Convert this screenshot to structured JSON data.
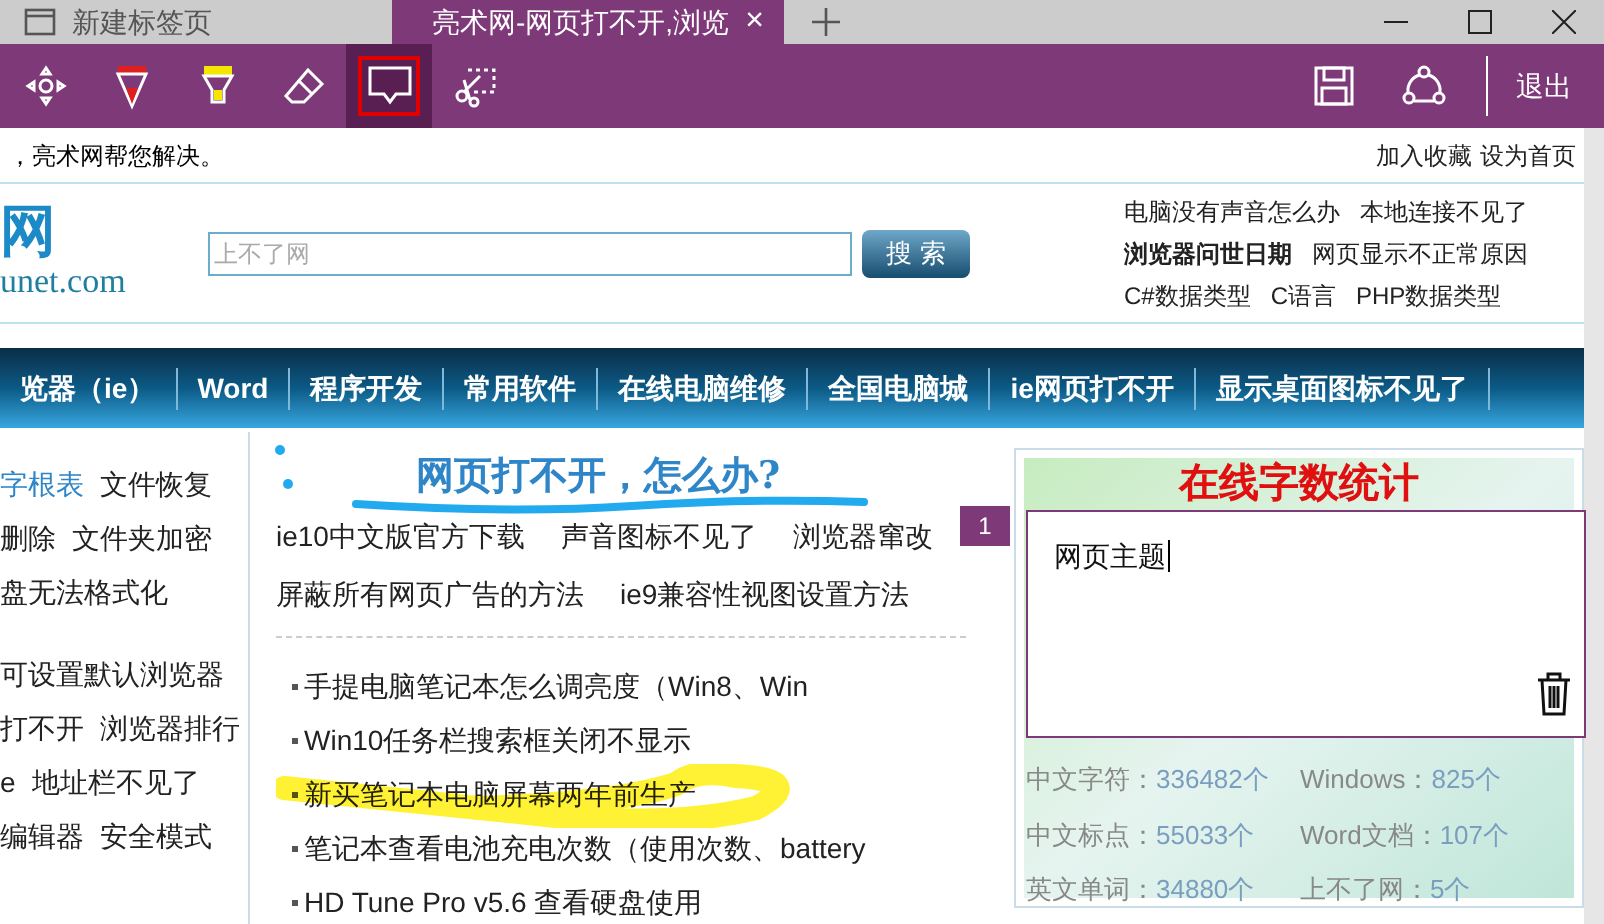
{
  "tabs": [
    {
      "title": "新建标签页",
      "kind": "page",
      "selected": false
    },
    {
      "title": "亮术网-网页打不开,浏览",
      "kind": "note",
      "selected": true,
      "close": "×"
    }
  ],
  "toolbar": {
    "tools": [
      {
        "kind": "touch",
        "selected": false
      },
      {
        "kind": "pen",
        "selected": false
      },
      {
        "kind": "highlighter",
        "selected": false
      },
      {
        "kind": "eraser",
        "selected": false
      },
      {
        "kind": "note",
        "selected": true
      },
      {
        "kind": "clip",
        "selected": false
      }
    ],
    "exit": "退出"
  },
  "page": {
    "top_left": "，亮术网帮您解决。",
    "top_links": [
      "加入收藏",
      "设为首页"
    ],
    "logo_mark": "网",
    "logo_domain": "unet.com",
    "search": {
      "placeholder": "上不了网",
      "button": "搜 索"
    },
    "header_links": [
      [
        {
          "text": "电脑没有声音怎么办",
          "bold": false
        },
        {
          "text": "本地连接不见了",
          "bold": false
        }
      ],
      [
        {
          "text": "浏览器问世日期",
          "bold": true
        },
        {
          "text": "网页显示不正常原因",
          "bold": false
        }
      ],
      [
        {
          "text": "C#数据类型",
          "bold": false
        },
        {
          "text": "C语言",
          "bold": false
        },
        {
          "text": "PHP数据类型",
          "bold": false
        }
      ]
    ],
    "nav": [
      "览器（ie）",
      "Word",
      "程序开发",
      "常用软件",
      "在线电脑维修",
      "全国电脑城",
      "ie网页打不开",
      "显示桌面图标不见了"
    ],
    "left_links": [
      [
        {
          "text": "字根表",
          "blue": true
        },
        {
          "text": "文件恢复",
          "blue": false
        }
      ],
      [
        {
          "text": "删除",
          "blue": false
        },
        {
          "text": "文件夹加密",
          "blue": false
        }
      ],
      [
        {
          "text": "盘无法格式化",
          "blue": false
        }
      ],
      [
        {
          "text": "可设置默认浏览器",
          "blue": false
        }
      ],
      [
        {
          "text": "打不开",
          "blue": false
        },
        {
          "text": "浏览器排行",
          "blue": false
        }
      ],
      [
        {
          "text": "e",
          "blue": false
        },
        {
          "text": "地址栏不见了",
          "blue": false
        }
      ],
      [
        {
          "text": "编辑器",
          "blue": false
        },
        {
          "text": "安全模式",
          "blue": false
        }
      ]
    ],
    "headline": "网页打不开，怎么办?",
    "hot_links": [
      [
        "ie10中文版官方下载",
        "声音图标不见了",
        "浏览器窜改"
      ],
      [
        "屏蔽所有网页广告的方法",
        "ie9兼容性视图设置方法"
      ]
    ],
    "articles": [
      "手提电脑笔记本怎么调亮度（Win8、Win",
      "Win10任务栏搜索框关闭不显示",
      "新买笔记本电脑屏幕两年前生产",
      "笔记本查看电池充电次数（使用次数、battery",
      "HD Tune Pro v5.6 查看硬盘使用"
    ],
    "widget": {
      "title": "在线字数统计",
      "stats": [
        [
          "中文字符：",
          "336482个"
        ],
        [
          "Windows：",
          "825个"
        ],
        [
          "中文标点：",
          "55033个"
        ],
        [
          "Word文档：",
          "107个"
        ],
        [
          "英文单词：",
          "34880个"
        ],
        [
          "上不了网：",
          "5个"
        ]
      ]
    }
  },
  "note": {
    "number": "1",
    "text": "网页主题"
  }
}
